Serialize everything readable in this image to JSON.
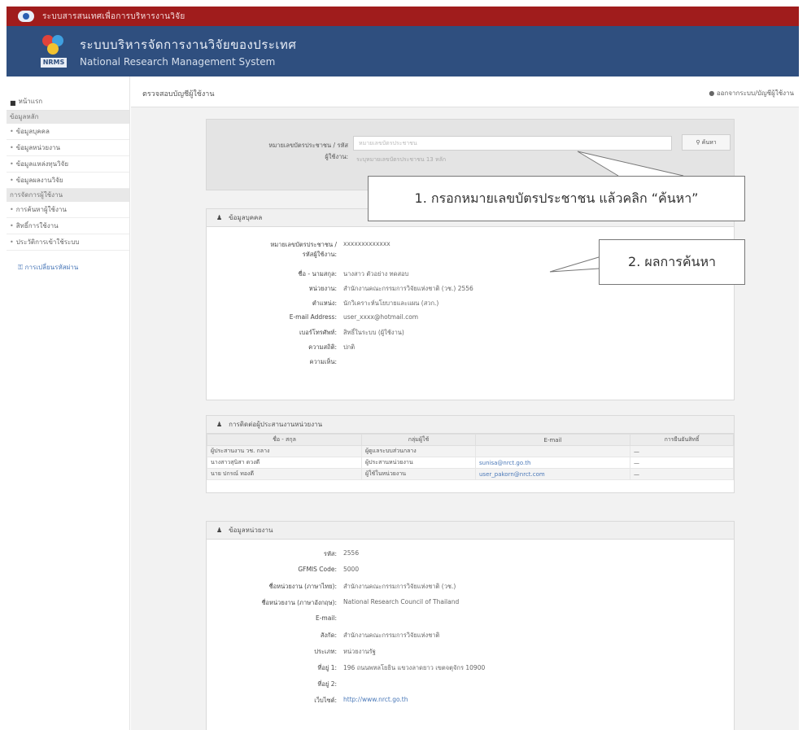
{
  "topbar": {
    "title": "ระบบสารสนเทศเพื่อการบริหารงานวิจัย"
  },
  "banner": {
    "logo_text": "NRMS",
    "title_th": "ระบบบริหารจัดการงานวิจัยของประเทศ",
    "title_en": "National Research Management System"
  },
  "sidebar": {
    "home": "หน้าแรก",
    "sections": [
      {
        "label": "ข้อมูลหลัก",
        "items": [
          "ข้อมูลบุคคล",
          "ข้อมูลหน่วยงาน",
          "ข้อมูลแหล่งทุนวิจัย",
          "ข้อมูลผลงานวิจัย"
        ]
      },
      {
        "label": "การจัดการผู้ใช้งาน",
        "items": [
          "การค้นหาผู้ใช้งาน",
          "สิทธิ์การใช้งาน",
          "ประวัติการเข้าใช้ระบบ"
        ]
      }
    ],
    "special": "การเปลี่ยนรหัสผ่าน"
  },
  "page": {
    "title": "ตรวจสอบบัญชีผู้ใช้งาน",
    "account": "ออกจากระบบ/บัญชีผู้ใช้งาน"
  },
  "search": {
    "label1": "หมายเลขบัตรประชาชน / รหัส",
    "label2": "ผู้ใช้งาน:",
    "placeholder": "หมายเลขบัตรประชาชน",
    "hint": "ระบุหมายเลขบัตรประชาชน 13 หลัก",
    "button": "ค้นหา"
  },
  "callouts": {
    "step1": "1. กรอกหมายเลขบัตรประชาชน แล้วคลิก “ค้นหา”",
    "step2": "2. ผลการค้นหา"
  },
  "person": {
    "header": "ข้อมูลบุคคล",
    "rows": [
      {
        "k": "หมายเลขบัตรประชาชน /",
        "k2": "รหัสผู้ใช้งาน:",
        "v": "xxxxxxxxxxxxx"
      },
      {
        "k": "ชื่อ - นามสกุล:",
        "v": "นางสาว ตัวอย่าง ทดสอบ"
      },
      {
        "k": "หน่วยงาน:",
        "v": "สำนักงานคณะกรรมการวิจัยแห่งชาติ (วช.) 2556"
      },
      {
        "k": "ตำแหน่ง:",
        "v": "นักวิเคราะห์นโยบายและแผน (สวก.)"
      },
      {
        "k": "E-mail Address:",
        "v": "user_xxxx@hotmail.com"
      },
      {
        "k": "เบอร์โทรศัพท์:",
        "v": "สิทธิ์ในระบบ (ผู้ใช้งาน)"
      },
      {
        "k": "ความสถิติ:",
        "v": "ปกติ"
      },
      {
        "k": "ความเห็น:",
        "v": ""
      }
    ]
  },
  "contacts": {
    "header": "การติดต่อผู้ประสานงานหน่วยงาน",
    "columns": [
      "ชื่อ - สกุล",
      "กลุ่มผู้ใช้",
      "E-mail",
      "การยืนยันสิทธิ์"
    ],
    "rows": [
      [
        "ผู้ประสานงาน วช. กลาง",
        "ผู้ดูแลระบบส่วนกลาง",
        "",
        "—"
      ],
      [
        "นางสาวสุนิสา ดวงดี",
        "ผู้ประสานหน่วยงาน",
        "sunisa@nrct.go.th",
        "—"
      ],
      [
        "นาย ปกรณ์ ทองดี",
        "ผู้ใช้ในหน่วยงาน",
        "user_pakorn@nrct.com",
        "—"
      ]
    ]
  },
  "agency": {
    "header": "ข้อมูลหน่วยงาน",
    "rows": [
      {
        "k": "รหัส:",
        "v": "2556"
      },
      {
        "k": "GFMIS Code:",
        "v": "5000"
      },
      {
        "k": "ชื่อหน่วยงาน (ภาษาไทย):",
        "v": "สำนักงานคณะกรรมการวิจัยแห่งชาติ (วช.)"
      },
      {
        "k": "ชื่อหน่วยงาน (ภาษาอังกฤษ):",
        "v": "National Research Council of Thailand"
      },
      {
        "k": "E-mail:",
        "v": ""
      },
      {
        "k": "สังกัด:",
        "v": "สำนักงานคณะกรรมการวิจัยแห่งชาติ"
      },
      {
        "k": "ประเภท:",
        "v": "หน่วยงานรัฐ"
      },
      {
        "k": "ที่อยู่ 1:",
        "v": "196 ถนนพหลโยธิน แขวงลาดยาว เขตจตุจักร 10900"
      },
      {
        "k": "ที่อยู่ 2:",
        "v": ""
      },
      {
        "k": "เว็บไซต์:",
        "v": "http://www.nrct.go.th"
      }
    ]
  }
}
